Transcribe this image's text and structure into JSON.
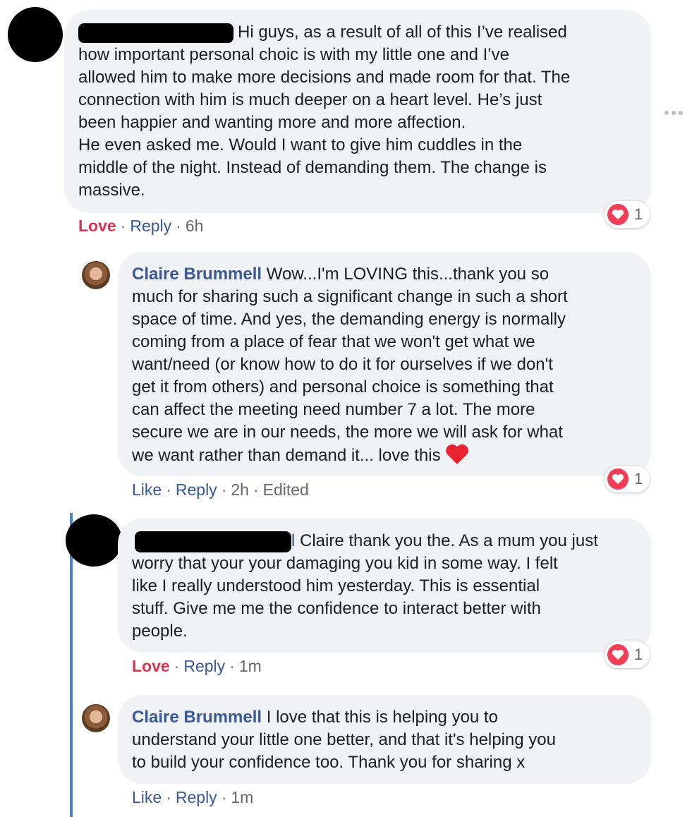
{
  "comment1": {
    "text": "Hi guys, as a result of all of this I’ve realised\nhow important personal choic is with my little one and I’ve\nallowed him to make more decisions and made room for that. The\nconnection with him is much deeper on a heart level. He’s just\nbeen happier and wanting more and more affection.\nHe even asked me. Would I want to give him cuddles in the\nmiddle of the night. Instead of demanding them. The change is\nmassive.",
    "reaction_count": "1",
    "action_love": "Love",
    "action_reply": "Reply",
    "time": "6h"
  },
  "reply1": {
    "author": "Claire Brummell",
    "text": " Wow...I'm LOVING this...thank you so\nmuch for sharing such a significant change in such a short\nspace of time. And yes, the demanding energy is normally\ncoming from a place of fear that we won't get what we\nwant/need (or know how to do it for ourselves if we don't\nget it from others) and personal choice is something that\ncan affect the meeting need number 7 a lot. The more\nsecure we are in our needs, the more we will ask for what\nwe want rather than demand it... love this ",
    "emoji": "❤️",
    "reaction_count": "1",
    "action_like": "Like",
    "action_reply": "Reply",
    "time": "2h",
    "edited": "Edited"
  },
  "reply2": {
    "mention_tail": "l",
    "text": " Claire thank you the. As a mum you just\nworry that your your damaging you kid in some way. I felt\nlike I really understood him yesterday. This is essential\nstuff. Give me me the confidence to interact better with\npeople.",
    "reaction_count": "1",
    "action_love": "Love",
    "action_reply": "Reply",
    "time": "1m"
  },
  "reply3": {
    "author": "Claire Brummell",
    "text": " I love that this is helping you to\nunderstand your little one better, and that it's helping you\nto build your confidence too. Thank you for sharing x",
    "action_like": "Like",
    "action_reply": "Reply",
    "time": "1m"
  },
  "sep": "·",
  "colors": {
    "bubble": "#f0f2f5",
    "author": "#385898",
    "love": "#e0324f",
    "heart": "#f33e58",
    "thread_line": "#4a7fd4"
  },
  "icons": [
    "more-options-icon",
    "heart-reaction-icon",
    "heart-emoji-icon"
  ]
}
